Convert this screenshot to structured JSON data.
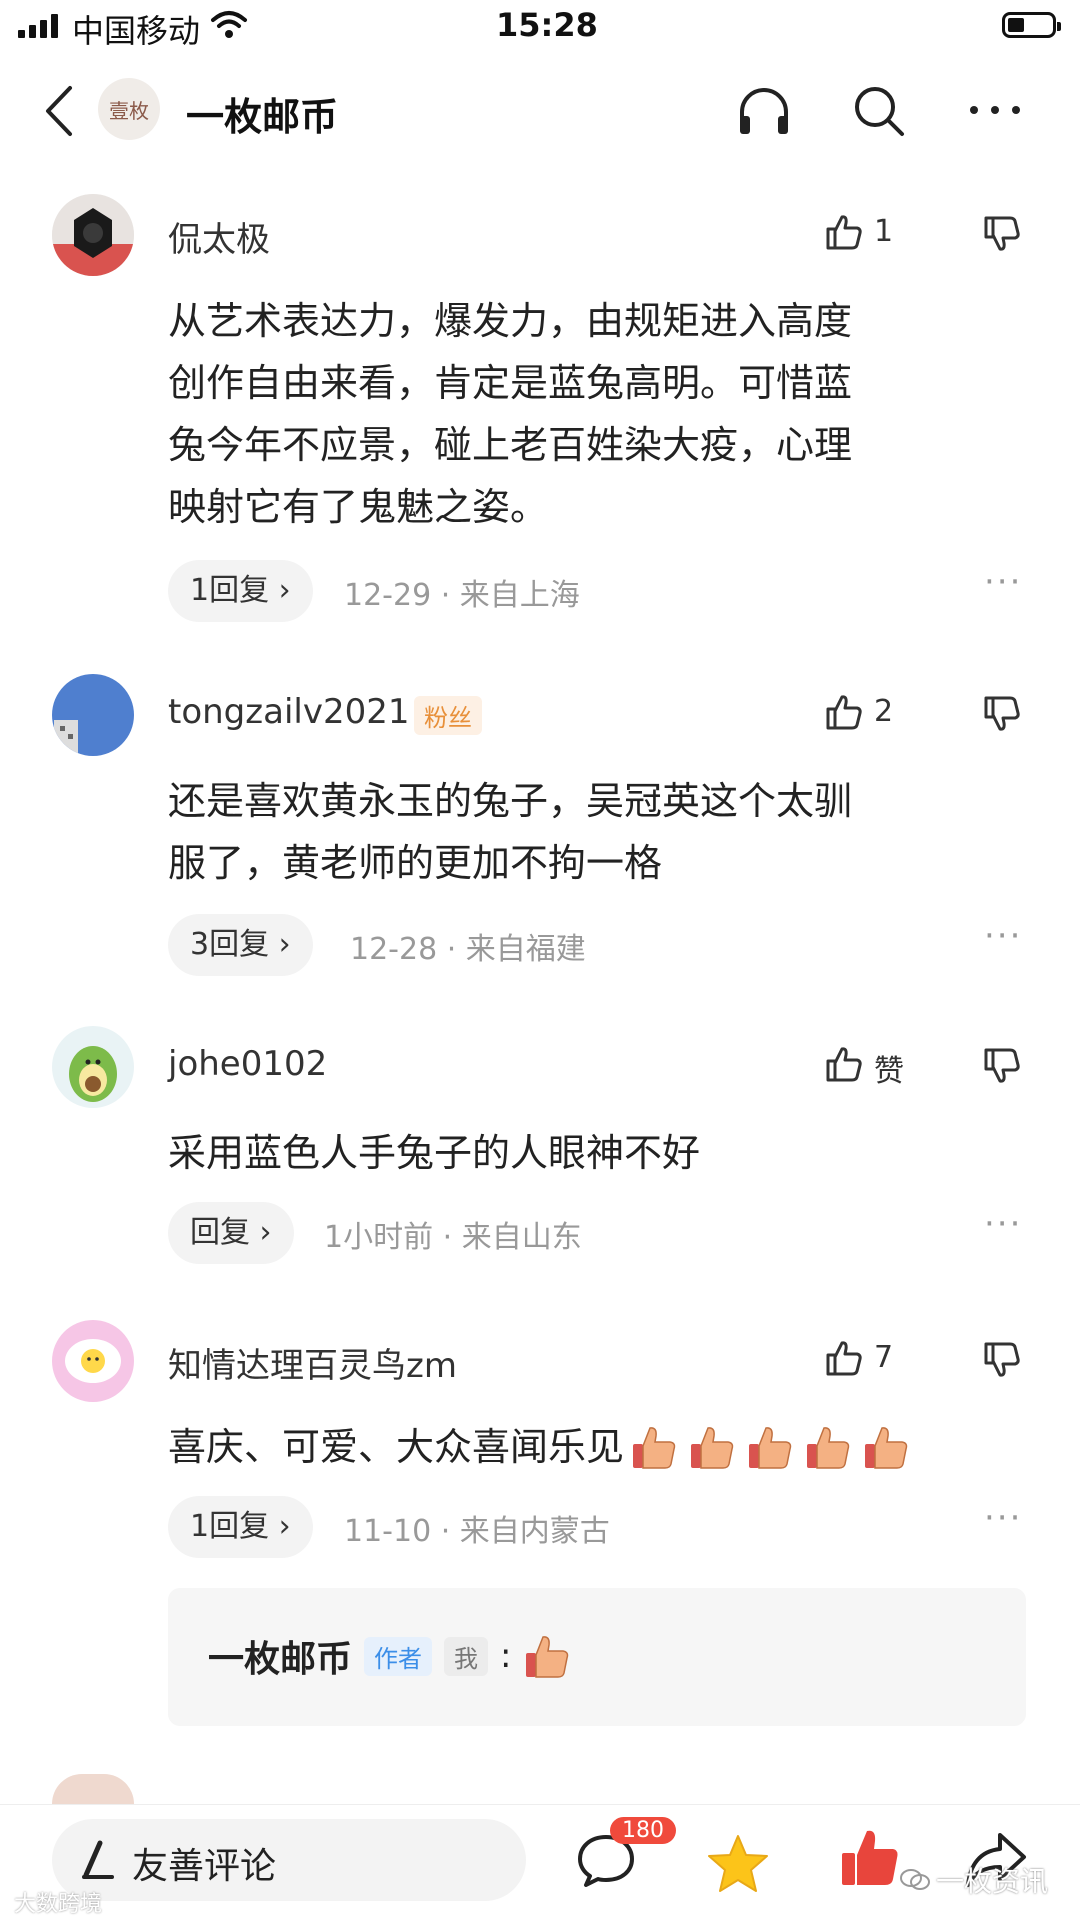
{
  "status_bar": {
    "carrier": "中国移动",
    "time": "15:28"
  },
  "header": {
    "avatar_text": "壹枚",
    "title": "一枚邮币"
  },
  "comments": [
    {
      "user": "侃太极",
      "likes": "1",
      "text": "从艺术表达力，爆发力，由规矩进入高度创作自由来看，肯定是蓝兔高明。可惜蓝兔今年不应景，碰上老百姓染大疫，心理映射它有了鬼魅之姿。",
      "reply": "1回复 ›",
      "date": "12-29",
      "location": "来自上海"
    },
    {
      "user": "tongzailv2021",
      "badge": "粉丝",
      "likes": "2",
      "text": "还是喜欢黄永玉的兔子，吴冠英这个太驯服了，黄老师的更加不拘一格",
      "reply": "3回复 ›",
      "date": "12-28",
      "location": "来自福建"
    },
    {
      "user": "johe0102",
      "likes": "赞",
      "text": "采用蓝色人手兔子的人眼神不好",
      "reply": "回复 ›",
      "date": "1小时前",
      "location": "来自山东"
    },
    {
      "user": "知情达理百灵鸟zm",
      "likes": "7",
      "text": "喜庆、可爱、大众喜闻乐见",
      "reply": "1回复 ›",
      "date": "11-10",
      "location": "来自内蒙古"
    }
  ],
  "sub_reply": {
    "user": "一枚邮币",
    "author_tag": "作者",
    "me_tag": "我",
    "colon": ":"
  },
  "bottom_bar": {
    "input_placeholder": "友善评论",
    "comment_count": "180"
  },
  "watermark": {
    "left": "大数跨境",
    "right": "一枚资讯"
  },
  "colors": {
    "like_red": "#e8453c",
    "star_yellow": "#fcc419",
    "fan_badge": "#e8903a",
    "author_badge": "#3b8ee8",
    "badge_red": "#f04a3c"
  }
}
